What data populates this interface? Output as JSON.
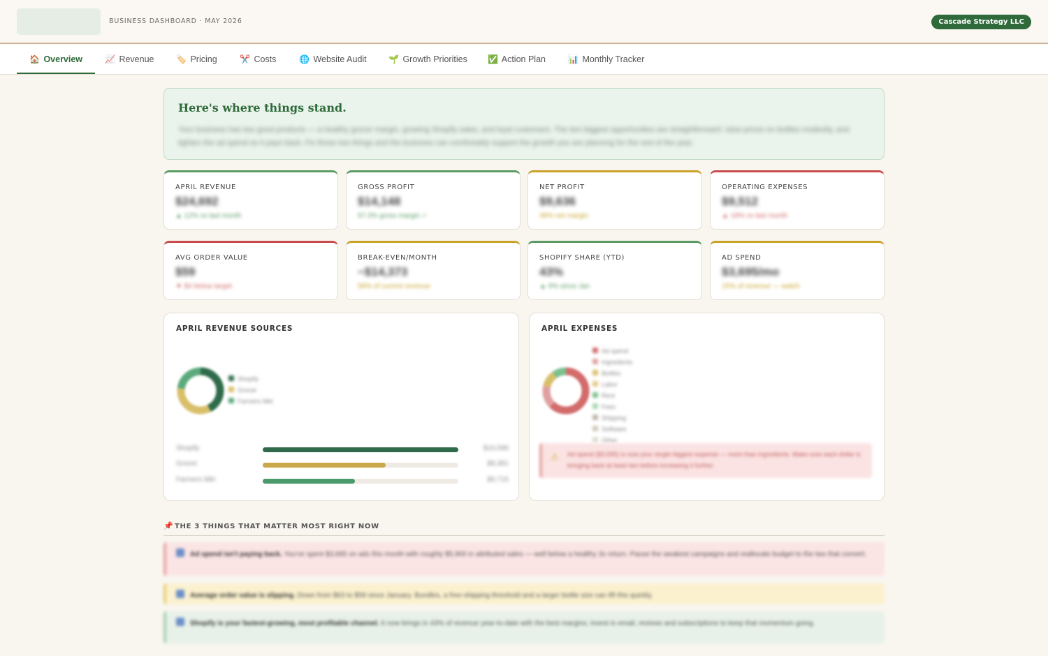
{
  "header": {
    "dashboard_label": "BUSINESS DASHBOARD · MAY 2026",
    "client_name": "Cascade Strategy LLC"
  },
  "tabs": [
    {
      "icon": "🏠",
      "label": "Overview",
      "active": true
    },
    {
      "icon": "📈",
      "label": "Revenue"
    },
    {
      "icon": "🏷️",
      "label": "Pricing"
    },
    {
      "icon": "✂️",
      "label": "Costs"
    },
    {
      "icon": "🌐",
      "label": "Website Audit"
    },
    {
      "icon": "🌱",
      "label": "Growth Priorities"
    },
    {
      "icon": "✅",
      "label": "Action Plan"
    },
    {
      "icon": "📊",
      "label": "Monthly Tracker"
    }
  ],
  "hero": {
    "title": "Here's where things stand.",
    "body": "Your business has two good products — a healthy grocer margin, growing Shopify sales, and loyal customers. The two biggest opportunities are straightforward: raise prices on bottles modestly, and tighten the ad spend so it pays back. Fix those two things and the business can comfortably support the growth you are planning for the rest of the year."
  },
  "kpis": [
    {
      "label": "APRIL REVENUE",
      "value": "$24,692",
      "sub": "▲ 12% vs last month",
      "tone": "green"
    },
    {
      "label": "GROSS PROFIT",
      "value": "$14,148",
      "sub": "57.3% gross margin ✓",
      "tone": "green"
    },
    {
      "label": "NET PROFIT",
      "value": "$9,636",
      "sub": "39% net margin",
      "tone": "gold"
    },
    {
      "label": "OPERATING EXPENSES",
      "value": "$9,512",
      "sub": "▲ 18% vs last month",
      "tone": "red"
    },
    {
      "label": "AVG ORDER VALUE",
      "value": "$59",
      "sub": "▼ $4 below target",
      "tone": "red"
    },
    {
      "label": "BREAK-EVEN/MONTH",
      "value": "~$14,373",
      "sub": "58% of current revenue",
      "tone": "gold"
    },
    {
      "label": "SHOPIFY SHARE (YTD)",
      "value": "43%",
      "sub": "▲ 9% since Jan",
      "tone": "green"
    },
    {
      "label": "AD SPEND",
      "value": "$3,695/mo",
      "sub": "15% of revenue — watch",
      "tone": "gold"
    }
  ],
  "revenue_panel": {
    "title": "APRIL REVENUE SOURCES",
    "legend": [
      "Shopify",
      "Grocer",
      "Farmers Mkt"
    ],
    "bars": [
      {
        "label": "Shopify",
        "value": "$10,596",
        "fraction": 1.0,
        "color": "#2f6b4a"
      },
      {
        "label": "Grocer",
        "value": "$8,381",
        "fraction": 0.63,
        "color": "#c9a94a"
      },
      {
        "label": "Farmers Mkt",
        "value": "$5,715",
        "fraction": 0.47,
        "color": "#4a9a6b"
      }
    ]
  },
  "expenses_panel": {
    "title": "APRIL EXPENSES",
    "legend": [
      "Ad spend",
      "Ingredients",
      "Bottles",
      "Labor",
      "Rent",
      "Fees",
      "Shipping",
      "Software",
      "Other"
    ],
    "alert": "Ad spend ($3,695) is now your single biggest expense — more than ingredients. Make sure each dollar is bringing back at least two before increasing it further."
  },
  "priorities": {
    "title": "THE 3 THINGS THAT MATTER MOST RIGHT NOW",
    "items": [
      {
        "lead": "Ad spend isn't paying back.",
        "text": "You've spent $3,695 on ads this month with roughly $5,900 in attributed sales — well below a healthy 3x return. Pause the weakest campaigns and reallocate budget to the two that convert.",
        "tone": "red"
      },
      {
        "lead": "Average order value is slipping.",
        "text": "Down from $63 to $59 since January. Bundles, a free-shipping threshold and a larger bottle size can lift this quickly.",
        "tone": "gold"
      },
      {
        "lead": "Shopify is your fastest-growing, most profitable channel.",
        "text": "It now brings in 43% of revenue year-to-date with the best margins; invest in email, reviews and subscriptions to keep that momentum going.",
        "tone": "green"
      }
    ]
  },
  "colors": {
    "brand_green": "#2f6b3a",
    "gold": "#c9a227",
    "red": "#c94a4a",
    "background": "#f9f6f0"
  }
}
